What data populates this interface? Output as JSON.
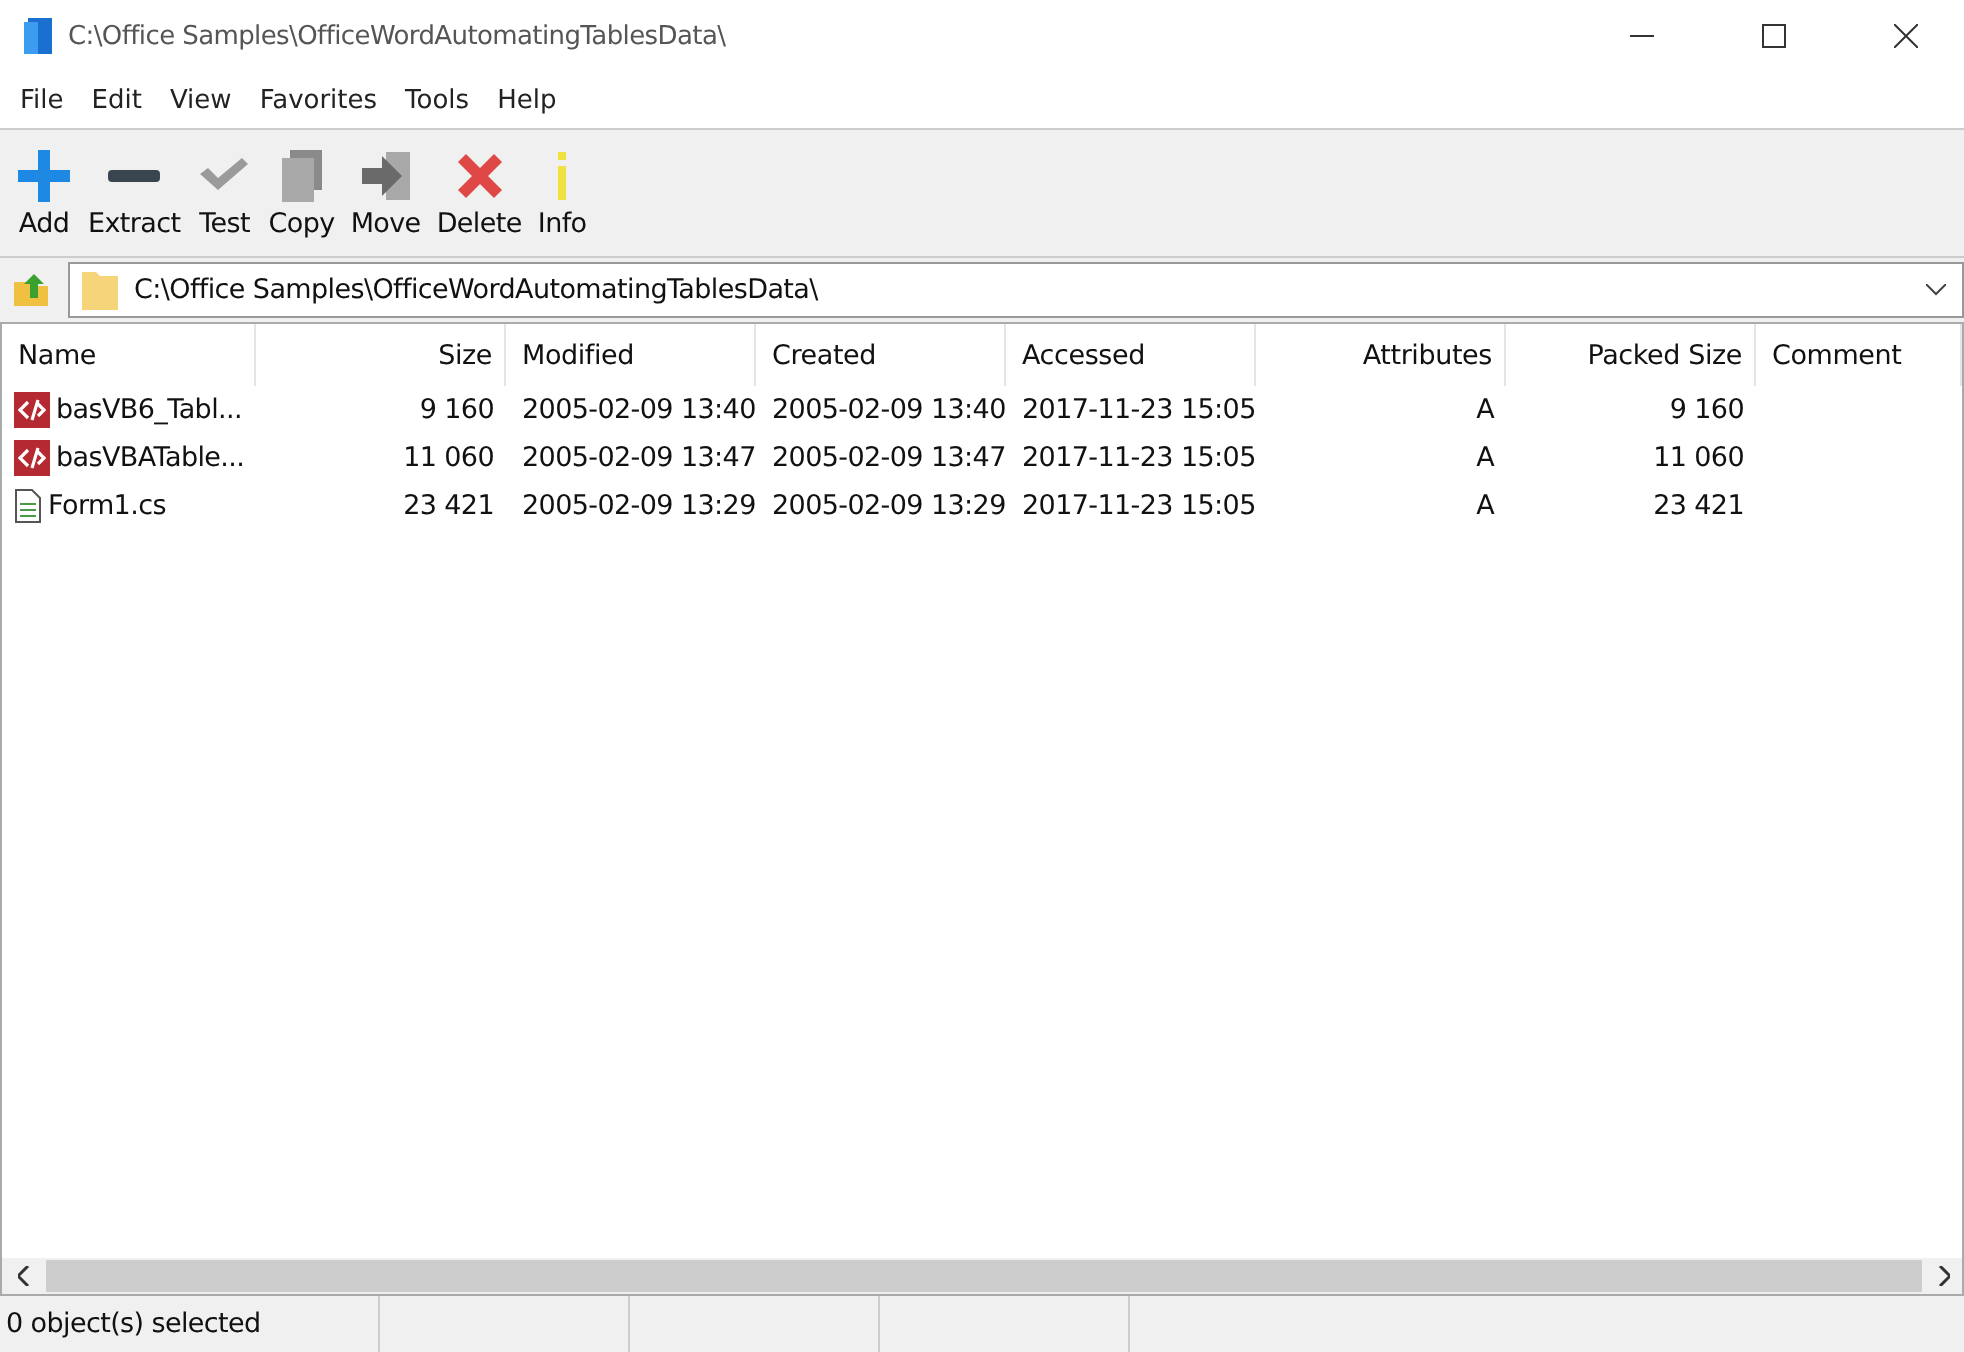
{
  "window": {
    "title": "C:\\Office Samples\\OfficeWordAutomatingTablesData\\"
  },
  "menu": [
    "File",
    "Edit",
    "View",
    "Favorites",
    "Tools",
    "Help"
  ],
  "toolbar": [
    {
      "label": "Add",
      "kind": "add"
    },
    {
      "label": "Extract",
      "kind": "extract"
    },
    {
      "label": "Test",
      "kind": "test"
    },
    {
      "label": "Copy",
      "kind": "copy"
    },
    {
      "label": "Move",
      "kind": "move"
    },
    {
      "label": "Delete",
      "kind": "delete"
    },
    {
      "label": "Info",
      "kind": "info"
    }
  ],
  "address": {
    "value": "C:\\Office Samples\\OfficeWordAutomatingTablesData\\"
  },
  "table": {
    "columns": [
      {
        "label": "Name",
        "kind": "text"
      },
      {
        "label": "Size",
        "kind": "number"
      },
      {
        "label": "Modified",
        "kind": "text"
      },
      {
        "label": "Created",
        "kind": "text"
      },
      {
        "label": "Accessed",
        "kind": "text"
      },
      {
        "label": "Attributes",
        "kind": "number"
      },
      {
        "label": "Packed Size",
        "kind": "number"
      },
      {
        "label": "Comment",
        "kind": "text"
      }
    ],
    "rows": [
      {
        "kind": "code",
        "cells": [
          "basVB6_Tabl...",
          "9 160",
          "2005-02-09 13:40",
          "2005-02-09 13:40",
          "2017-11-23 15:05",
          "A",
          "9 160"
        ]
      },
      {
        "kind": "code",
        "cells": [
          "basVBATable...",
          "11 060",
          "2005-02-09 13:47",
          "2005-02-09 13:47",
          "2017-11-23 15:05",
          "A",
          "11 060"
        ]
      },
      {
        "kind": "text",
        "cells": [
          "Form1.cs",
          "23 421",
          "2005-02-09 13:29",
          "2005-02-09 13:29",
          "2017-11-23 15:05",
          "A",
          "23 421"
        ]
      }
    ]
  },
  "status_bar": [
    "0 object(s) selected"
  ]
}
